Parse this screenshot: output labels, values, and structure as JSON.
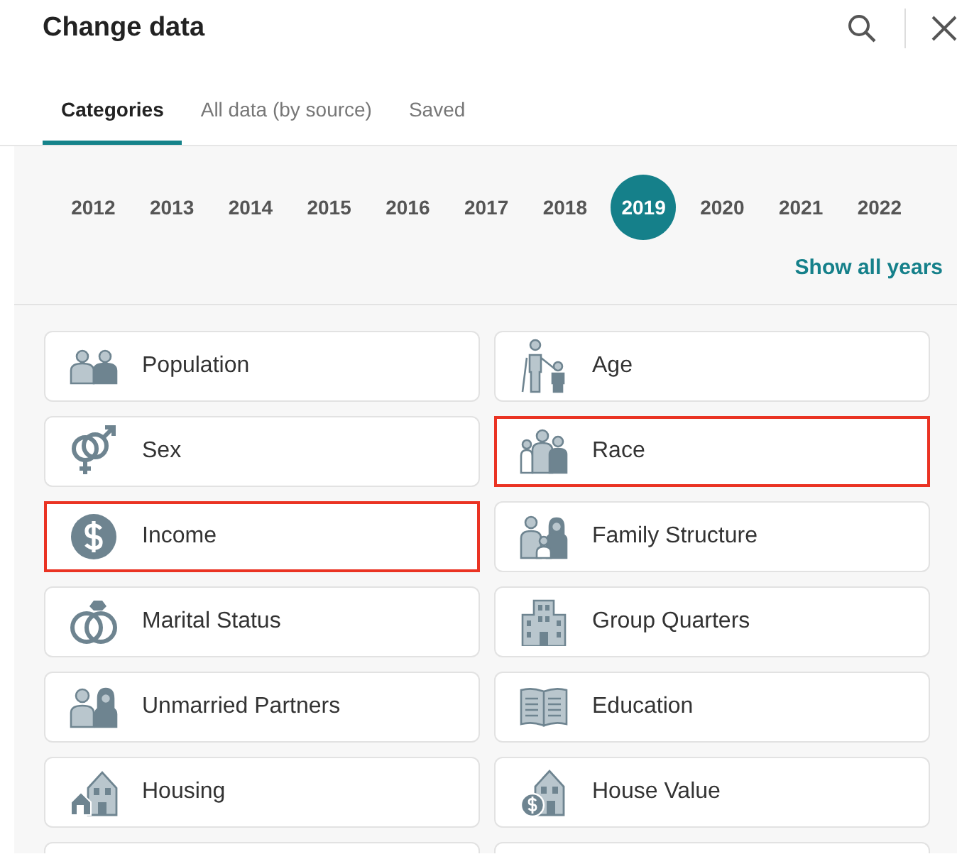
{
  "dialog": {
    "title": "Change data"
  },
  "tabs": [
    {
      "label": "Categories",
      "selected": true
    },
    {
      "label": "All data (by source)",
      "selected": false
    },
    {
      "label": "Saved",
      "selected": false
    }
  ],
  "years": [
    {
      "label": "2012",
      "selected": false
    },
    {
      "label": "2013",
      "selected": false
    },
    {
      "label": "2014",
      "selected": false
    },
    {
      "label": "2015",
      "selected": false
    },
    {
      "label": "2016",
      "selected": false
    },
    {
      "label": "2017",
      "selected": false
    },
    {
      "label": "2018",
      "selected": false
    },
    {
      "label": "2019",
      "selected": true
    },
    {
      "label": "2020",
      "selected": false
    },
    {
      "label": "2021",
      "selected": false
    },
    {
      "label": "2022",
      "selected": false
    }
  ],
  "show_all_years": "Show all years",
  "categories": [
    {
      "label": "Population",
      "highlighted": false
    },
    {
      "label": "Age",
      "highlighted": false
    },
    {
      "label": "Sex",
      "highlighted": false
    },
    {
      "label": "Race",
      "highlighted": true
    },
    {
      "label": "Income",
      "highlighted": true
    },
    {
      "label": "Family Structure",
      "highlighted": false
    },
    {
      "label": "Marital Status",
      "highlighted": false
    },
    {
      "label": "Group Quarters",
      "highlighted": false
    },
    {
      "label": "Unmarried Partners",
      "highlighted": false
    },
    {
      "label": "Education",
      "highlighted": false
    },
    {
      "label": "Housing",
      "highlighted": false
    },
    {
      "label": "House Value",
      "highlighted": false
    }
  ]
}
